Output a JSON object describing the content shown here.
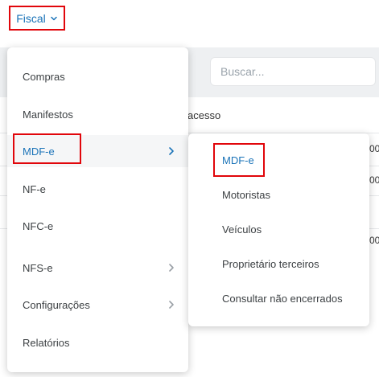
{
  "nav": {
    "fiscal_label": "Fiscal",
    "fiscal_icon": "chevron-down-icon"
  },
  "background": {
    "search_placeholder": "Buscar...",
    "column_header": "acesso",
    "row_fragments": [
      "00",
      "00",
      "00"
    ]
  },
  "menu": {
    "items": [
      {
        "label": "Compras",
        "has_submenu": false
      },
      {
        "label": "Manifestos",
        "has_submenu": false
      },
      {
        "label": "MDF-e",
        "has_submenu": true,
        "active": true
      },
      {
        "label": "NF-e",
        "has_submenu": false
      },
      {
        "label": "NFC-e",
        "has_submenu": false
      },
      {
        "label": "NFS-e",
        "has_submenu": true
      },
      {
        "label": "Configurações",
        "has_submenu": true
      },
      {
        "label": "Relatórios",
        "has_submenu": false
      }
    ]
  },
  "submenu": {
    "items": [
      {
        "label": "MDF-e",
        "active": true
      },
      {
        "label": "Motoristas"
      },
      {
        "label": "Veículos"
      },
      {
        "label": "Proprietário terceiros"
      },
      {
        "label": "Consultar não encerrados"
      }
    ]
  },
  "colors": {
    "accent": "#1a73b8",
    "highlight_border": "#e1060b",
    "text": "#3c4043",
    "background_band": "#eef0f2"
  }
}
